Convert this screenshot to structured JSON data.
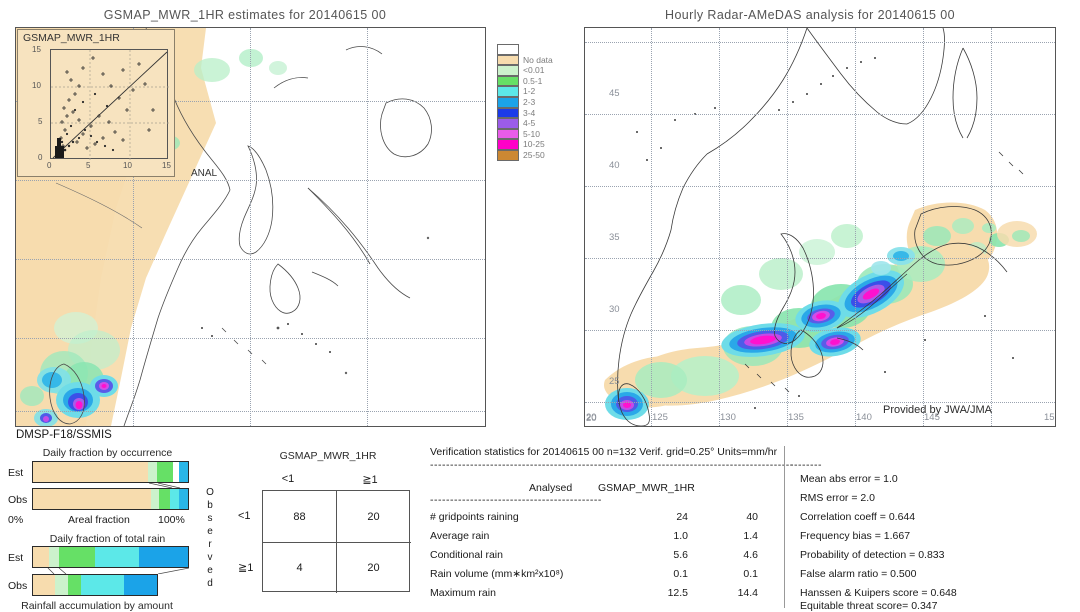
{
  "left_panel": {
    "title": "GSMAP_MWR_1HR estimates for 20140615 00",
    "inset_label": "GSMAP_MWR_1HR",
    "anal_label": "ANAL",
    "inset_y_ticks": [
      "15",
      "10",
      "5",
      "0"
    ],
    "inset_x_ticks": [
      "0",
      "5",
      "10",
      "15"
    ],
    "sensor": "DMSP-F18/SSMIS"
  },
  "right_panel": {
    "title": "Hourly Radar-AMeDAS analysis for 20140615 00",
    "credit": "Provided by JWA/JMA",
    "lat_ticks": [
      "45",
      "40",
      "35",
      "30",
      "25",
      "20"
    ],
    "lon_ticks": [
      "20",
      "125",
      "130",
      "135",
      "140",
      "145",
      "15"
    ]
  },
  "colorbar": {
    "entries": [
      {
        "label": "",
        "color": "#ffffff"
      },
      {
        "label": "No data",
        "color": "#f7dcae"
      },
      {
        "label": "<0.01",
        "color": "#ccf2cc"
      },
      {
        "label": "0.5-1",
        "color": "#66e066"
      },
      {
        "label": "1-2",
        "color": "#5ce8e8"
      },
      {
        "label": "2-3",
        "color": "#1ba3e8"
      },
      {
        "label": "3-4",
        "color": "#1b3be8"
      },
      {
        "label": "4-5",
        "color": "#9b5ce8"
      },
      {
        "label": "5-10",
        "color": "#e85ce8"
      },
      {
        "label": "10-25",
        "color": "#ff00c8"
      },
      {
        "label": "25-50",
        "color": "#cc8833"
      }
    ]
  },
  "fraction_panels": {
    "occurrence_title": "Daily fraction by occurrence",
    "total_rain_title": "Daily fraction of total rain",
    "bottom_caption": "Rainfall accumulation by amount",
    "est_label": "Est",
    "obs_label": "Obs",
    "axis_left": "0%",
    "axis_center": "Areal fraction",
    "axis_right": "100%",
    "occurrence_est": [
      {
        "frac": 0.745,
        "color": "#f7dcae"
      },
      {
        "frac": 0.055,
        "color": "#ccf2cc"
      },
      {
        "frac": 0.105,
        "color": "#66e066"
      },
      {
        "frac": 0.02,
        "color": "#ffffff"
      },
      {
        "frac": 0.02,
        "color": "#ffffff"
      },
      {
        "frac": 0.055,
        "color": "#29b6e8"
      }
    ],
    "occurrence_obs": [
      {
        "frac": 0.76,
        "color": "#f7dcae"
      },
      {
        "frac": 0.055,
        "color": "#ccf2cc"
      },
      {
        "frac": 0.07,
        "color": "#66e066"
      },
      {
        "frac": 0.06,
        "color": "#5ce8e8"
      },
      {
        "frac": 0.055,
        "color": "#29b6e8"
      }
    ],
    "total_rain_est": [
      {
        "frac": 0.1,
        "color": "#f7dcae"
      },
      {
        "frac": 0.07,
        "color": "#ccf2cc"
      },
      {
        "frac": 0.23,
        "color": "#66e066"
      },
      {
        "frac": 0.285,
        "color": "#5ce8e8"
      },
      {
        "frac": 0.315,
        "color": "#1ba3e8"
      }
    ],
    "total_rain_obs": [
      {
        "frac": 0.135,
        "color": "#f7dcae"
      },
      {
        "frac": 0.075,
        "color": "#ccf2cc"
      },
      {
        "frac": 0.08,
        "color": "#66e066"
      },
      {
        "frac": 0.26,
        "color": "#5ce8e8"
      },
      {
        "frac": 0.2,
        "color": "#1ba3e8"
      }
    ]
  },
  "contingency": {
    "title": "GSMAP_MWR_1HR",
    "col_headers": [
      "<1",
      "≧1"
    ],
    "row_headers": [
      "<1",
      "≧1"
    ],
    "observed_label": "Observed",
    "cells": [
      [
        "88",
        "20"
      ],
      [
        "4",
        "20"
      ]
    ]
  },
  "verification": {
    "header": "Verification statistics for 20140615 00  n=132  Verif. grid=0.25°  Units=mm/hr",
    "col_header_left": "Analysed",
    "col_header_right": "GSMAP_MWR_1HR",
    "rows": [
      {
        "label": "# gridpoints raining",
        "analysed": "24",
        "estimate": "40"
      },
      {
        "label": "Average rain",
        "analysed": "1.0",
        "estimate": "1.4"
      },
      {
        "label": "Conditional rain",
        "analysed": "5.6",
        "estimate": "4.6"
      },
      {
        "label": "Rain volume (mm∗km²x10⁸)",
        "analysed": "0.1",
        "estimate": "0.1"
      },
      {
        "label": "Maximum rain",
        "analysed": "12.5",
        "estimate": "14.4"
      }
    ],
    "scores": [
      "Mean abs error = 1.0",
      "RMS error = 2.0",
      "Correlation coeff = 0.644",
      "Frequency bias = 1.667",
      "Probability of detection = 0.833",
      "False alarm ratio = 0.500",
      "Hanssen & Kuipers score = 0.648",
      "Equitable threat score= 0.347"
    ]
  }
}
